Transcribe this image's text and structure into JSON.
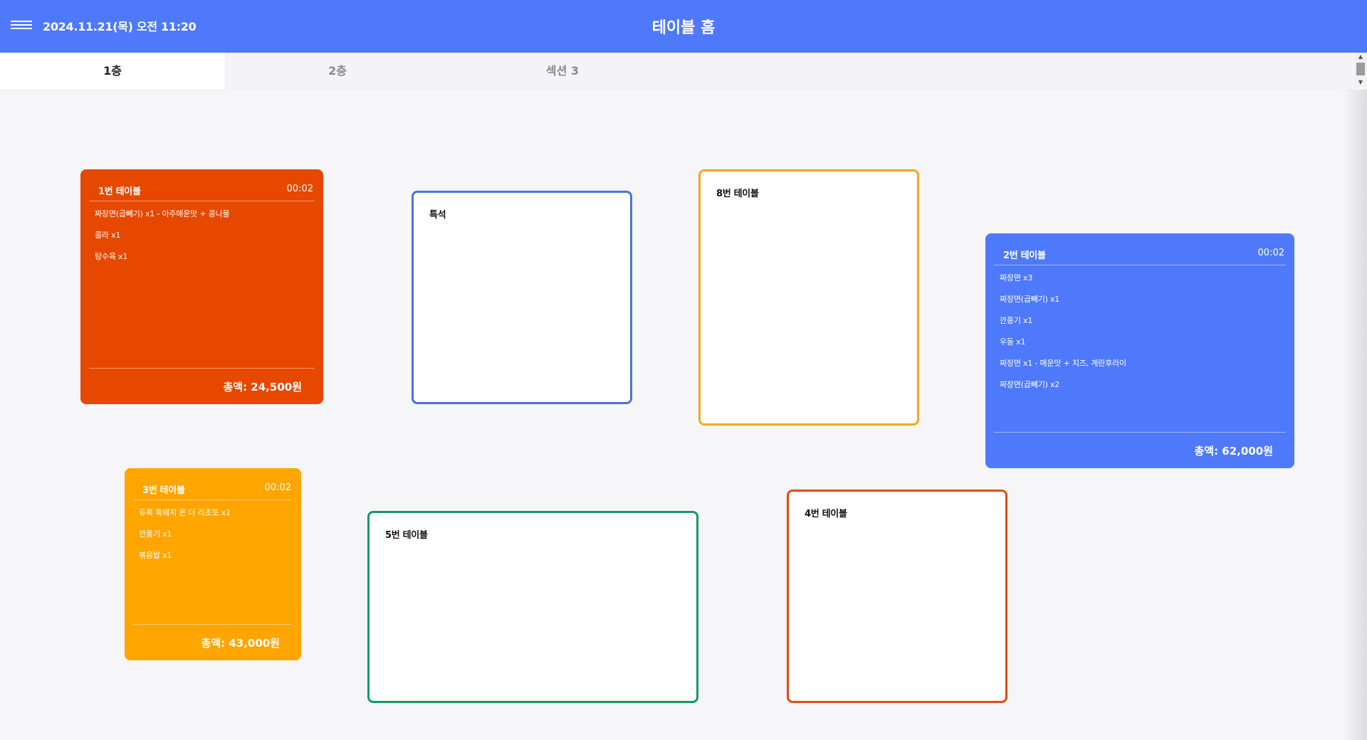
{
  "header": {
    "datetime": "2024.11.21(목) 오전 11:20",
    "title": "테이블 홈",
    "menu_icon": "hamburger-menu-icon"
  },
  "tabs": [
    {
      "label": "1층",
      "active": true
    },
    {
      "label": "2층",
      "active": false
    },
    {
      "label": "섹션 3",
      "active": false
    }
  ],
  "tables": {
    "t1": {
      "name": "1번 테이블",
      "time": "00:02",
      "color": "#e64800",
      "items": [
        "짜장면(곱빼기) x1 - 아주매운맛 + 콩나물",
        "콜라 x1",
        "탕수육 x1"
      ],
      "total": "총액: 24,500원"
    },
    "special": {
      "name": "특석",
      "color": "#4a72e0"
    },
    "t8": {
      "name": "8번 테이블",
      "color": "#f5a623"
    },
    "t2": {
      "name": "2번 테이블",
      "time": "00:02",
      "color": "#4f79fb",
      "items": [
        "짜장면 x3",
        "짜장면(곱빼기) x1",
        "깐풍기 x1",
        "우동 x1",
        "짜장면 x1 - 매운맛 + 치즈, 계란후라이",
        "짜장면(곱빼기) x2"
      ],
      "total": "총액: 62,000원"
    },
    "t3": {
      "name": "3번 테이블",
      "time": "00:02",
      "color": "#ffa500",
      "items": [
        "듀록 흑돼지 온 더 리조또 x1",
        "깐풍기 x1",
        "볶음밥 x1"
      ],
      "total": "총액: 43,000원"
    },
    "t5": {
      "name": "5번 테이블",
      "color": "#149a63"
    },
    "t4": {
      "name": "4번 테이블",
      "color": "#e04b1a"
    }
  }
}
